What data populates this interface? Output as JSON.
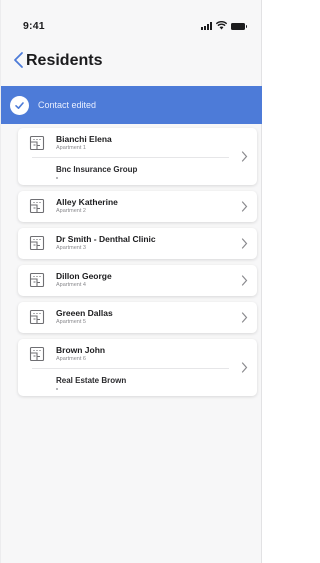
{
  "status_bar": {
    "time": "9:41"
  },
  "nav": {
    "title": "Residents"
  },
  "toast": {
    "message": "Contact edited"
  },
  "residents": [
    {
      "name": "Bianchi Elena",
      "apartment": "Apartment 1",
      "company": "Bnc Insurance Group"
    },
    {
      "name": "Alley Katherine",
      "apartment": "Apartment 2"
    },
    {
      "name": "Dr Smith - Denthal Clinic",
      "apartment": "Apartment 3"
    },
    {
      "name": "Dillon George",
      "apartment": "Apartment 4"
    },
    {
      "name": "Greeen Dallas",
      "apartment": "Apartment 5"
    },
    {
      "name": "Brown John",
      "apartment": "Apartment 6",
      "company": "Real Estate Brown"
    }
  ],
  "colors": {
    "toast_background": "#4d7bd8",
    "back_arrow": "#4d7bd8",
    "icon_stroke": "#6f6f73"
  }
}
